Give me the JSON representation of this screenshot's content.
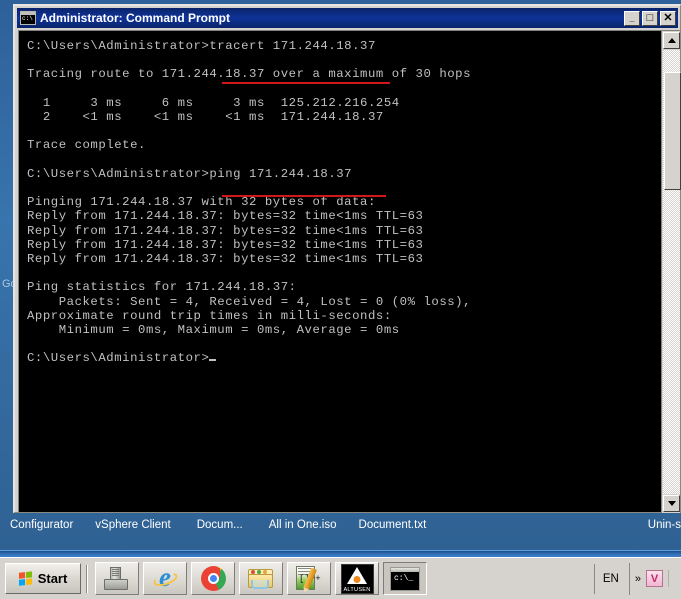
{
  "window": {
    "title": "Administrator: Command Prompt",
    "icon": "command-prompt-icon",
    "minimize_label": "_",
    "maximize_label": "□",
    "close_label": "✕"
  },
  "console": {
    "lines": [
      "C:\\Users\\Administrator>tracert 171.244.18.37",
      "",
      "Tracing route to 171.244.18.37 over a maximum of 30 hops",
      "",
      "  1     3 ms     6 ms     3 ms  125.212.216.254",
      "  2    <1 ms    <1 ms    <1 ms  171.244.18.37",
      "",
      "Trace complete.",
      "",
      "C:\\Users\\Administrator>ping 171.244.18.37",
      "",
      "Pinging 171.244.18.37 with 32 bytes of data:",
      "Reply from 171.244.18.37: bytes=32 time<1ms TTL=63",
      "Reply from 171.244.18.37: bytes=32 time<1ms TTL=63",
      "Reply from 171.244.18.37: bytes=32 time<1ms TTL=63",
      "Reply from 171.244.18.37: bytes=32 time<1ms TTL=63",
      "",
      "Ping statistics for 171.244.18.37:",
      "    Packets: Sent = 4, Received = 4, Lost = 0 (0% loss),",
      "Approximate round trip times in milli-seconds:",
      "    Minimum = 0ms, Maximum = 0ms, Average = 0ms",
      "",
      "C:\\Users\\Administrator>"
    ],
    "commands": {
      "tracert": "tracert 171.244.18.37",
      "ping": "ping 171.244.18.37"
    },
    "target_ip": "171.244.18.37",
    "gateway_ip": "125.212.216.254",
    "hops": [
      {
        "hop": "1",
        "rtt1": "3 ms",
        "rtt2": "6 ms",
        "rtt3": "3 ms",
        "host": "125.212.216.254"
      },
      {
        "hop": "2",
        "rtt1": "<1 ms",
        "rtt2": "<1 ms",
        "rtt3": "<1 ms",
        "host": "171.244.18.37"
      }
    ],
    "ping_stats": {
      "sent": "4",
      "received": "4",
      "lost": "0",
      "loss_percent": "0%",
      "minimum": "0ms",
      "maximum": "0ms",
      "average": "0ms",
      "ttl": "63",
      "bytes": "32"
    },
    "annotation_color": "#d01818"
  },
  "desktop": {
    "watermark": "Go"
  },
  "window_strip": {
    "items": [
      {
        "label": "Configurator"
      },
      {
        "label": "vSphere Client"
      },
      {
        "label": "Docum..."
      },
      {
        "label": "All in One.iso"
      },
      {
        "label": "Document.txt"
      }
    ],
    "right_item": "Unin-s"
  },
  "taskbar": {
    "start_label": "Start",
    "quick_launch": [
      {
        "name": "server-manager-icon",
        "tooltip": "Server Manager"
      },
      {
        "name": "internet-explorer-icon",
        "tooltip": "Internet Explorer"
      },
      {
        "name": "chrome-icon",
        "tooltip": "Google Chrome"
      },
      {
        "name": "file-explorer-icon",
        "tooltip": "Windows Explorer"
      },
      {
        "name": "notepadplusplus-icon",
        "tooltip": "Notepad++"
      },
      {
        "name": "altusen-icon",
        "tooltip": "ALTUSEN"
      },
      {
        "name": "command-prompt-icon",
        "tooltip": "Command Prompt"
      }
    ],
    "altusen_label": "ALTUSEN",
    "tray": {
      "language": "EN",
      "chevron": "»",
      "shield_label": "V"
    }
  },
  "scrollbar": {
    "up_arrow": "▲",
    "down_arrow": "▼"
  }
}
